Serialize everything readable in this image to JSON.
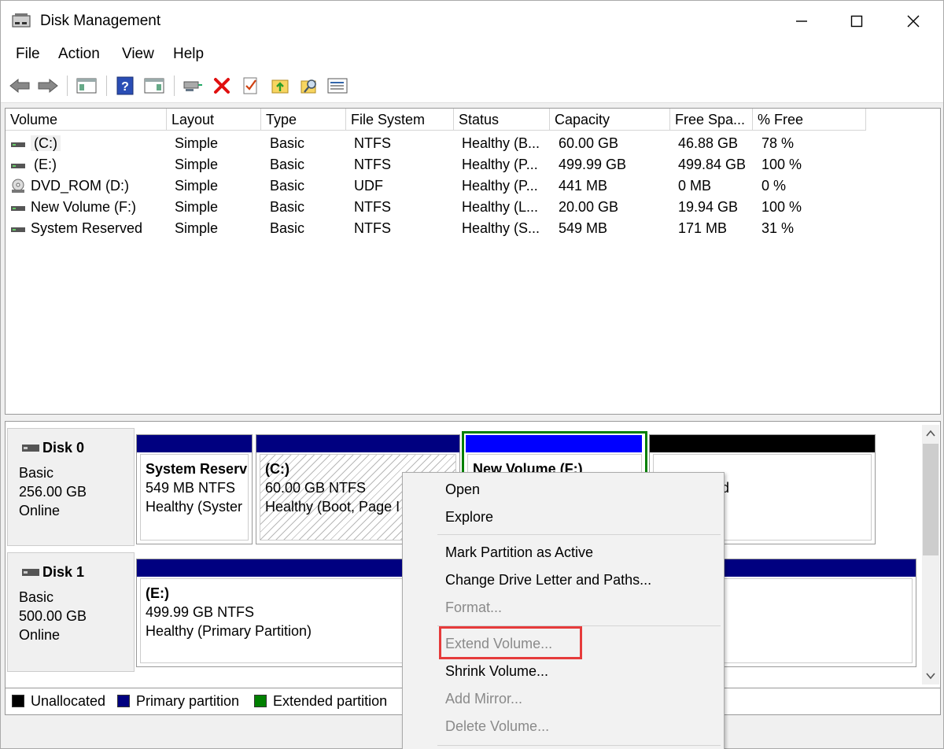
{
  "window": {
    "title": "Disk Management"
  },
  "menu": [
    "File",
    "Action",
    "View",
    "Help"
  ],
  "toolbar": {
    "icons": [
      "back-arrow-icon",
      "forward-arrow-icon",
      "console-tree-icon",
      "help-icon",
      "action-pane-icon",
      "connect-icon",
      "delete-icon",
      "properties-check-icon",
      "folder-up-icon",
      "search-folder-icon",
      "list-view-icon"
    ]
  },
  "volume_table": {
    "columns": [
      "Volume",
      "Layout",
      "Type",
      "File System",
      "Status",
      "Capacity",
      "Free Spa...",
      "% Free"
    ],
    "rows": [
      {
        "volume": "(C:)",
        "layout": "Simple",
        "type": "Basic",
        "fs": "NTFS",
        "status": "Healthy (B...",
        "capacity": "60.00 GB",
        "free": "46.88 GB",
        "pct": "78 %",
        "icon": "drive-icon"
      },
      {
        "volume": "(E:)",
        "layout": "Simple",
        "type": "Basic",
        "fs": "NTFS",
        "status": "Healthy (P...",
        "capacity": "499.99 GB",
        "free": "499.84 GB",
        "pct": "100 %",
        "icon": "drive-icon"
      },
      {
        "volume": "DVD_ROM (D:)",
        "layout": "Simple",
        "type": "Basic",
        "fs": "UDF",
        "status": "Healthy (P...",
        "capacity": "441 MB",
        "free": "0 MB",
        "pct": "0 %",
        "icon": "cd-drive-icon"
      },
      {
        "volume": "New Volume (F:)",
        "layout": "Simple",
        "type": "Basic",
        "fs": "NTFS",
        "status": "Healthy (L...",
        "capacity": "20.00 GB",
        "free": "19.94 GB",
        "pct": "100 %",
        "icon": "drive-icon"
      },
      {
        "volume": "System Reserved",
        "layout": "Simple",
        "type": "Basic",
        "fs": "NTFS",
        "status": "Healthy (S...",
        "capacity": "549 MB",
        "free": "171 MB",
        "pct": "31 %",
        "icon": "drive-icon"
      }
    ]
  },
  "disks": [
    {
      "name": "Disk 0",
      "kind": "Basic",
      "size": "256.00 GB",
      "state": "Online",
      "partitions": [
        {
          "name": "System Reserv",
          "detail": "549 MB NTFS",
          "status": "Healthy (Syster"
        },
        {
          "name": "(C:)",
          "detail": "60.00 GB NTFS",
          "status": "Healthy (Boot, Page I"
        },
        {
          "name": "New Volume  (F:)",
          "detail": "",
          "status": ""
        },
        {
          "name": "",
          "detail": "",
          "status": "ed"
        }
      ]
    },
    {
      "name": "Disk 1",
      "kind": "Basic",
      "size": "500.00 GB",
      "state": "Online",
      "partitions": [
        {
          "name": "(E:)",
          "detail": "499.99 GB NTFS",
          "status": "Healthy (Primary Partition)"
        }
      ]
    }
  ],
  "legend": [
    {
      "label": "Unallocated",
      "color": "#000000"
    },
    {
      "label": "Primary partition",
      "color": "#000080"
    },
    {
      "label": "Extended partition",
      "color": "#008000"
    }
  ],
  "context_menu": [
    {
      "label": "Open",
      "enabled": true
    },
    {
      "label": "Explore",
      "enabled": true
    },
    {
      "label": "Mark Partition as Active",
      "enabled": true
    },
    {
      "label": "Change Drive Letter and Paths...",
      "enabled": true
    },
    {
      "label": "Format...",
      "enabled": false
    },
    {
      "label": "Extend Volume...",
      "enabled": false
    },
    {
      "label": "Shrink Volume...",
      "enabled": true
    },
    {
      "label": "Add Mirror...",
      "enabled": false
    },
    {
      "label": "Delete Volume...",
      "enabled": false
    }
  ],
  "colors": {
    "primary": "#000080",
    "extended": "#008000",
    "unallocated": "#000000",
    "selected_bar": "#0000ff",
    "highlight": "#e63b3b"
  }
}
